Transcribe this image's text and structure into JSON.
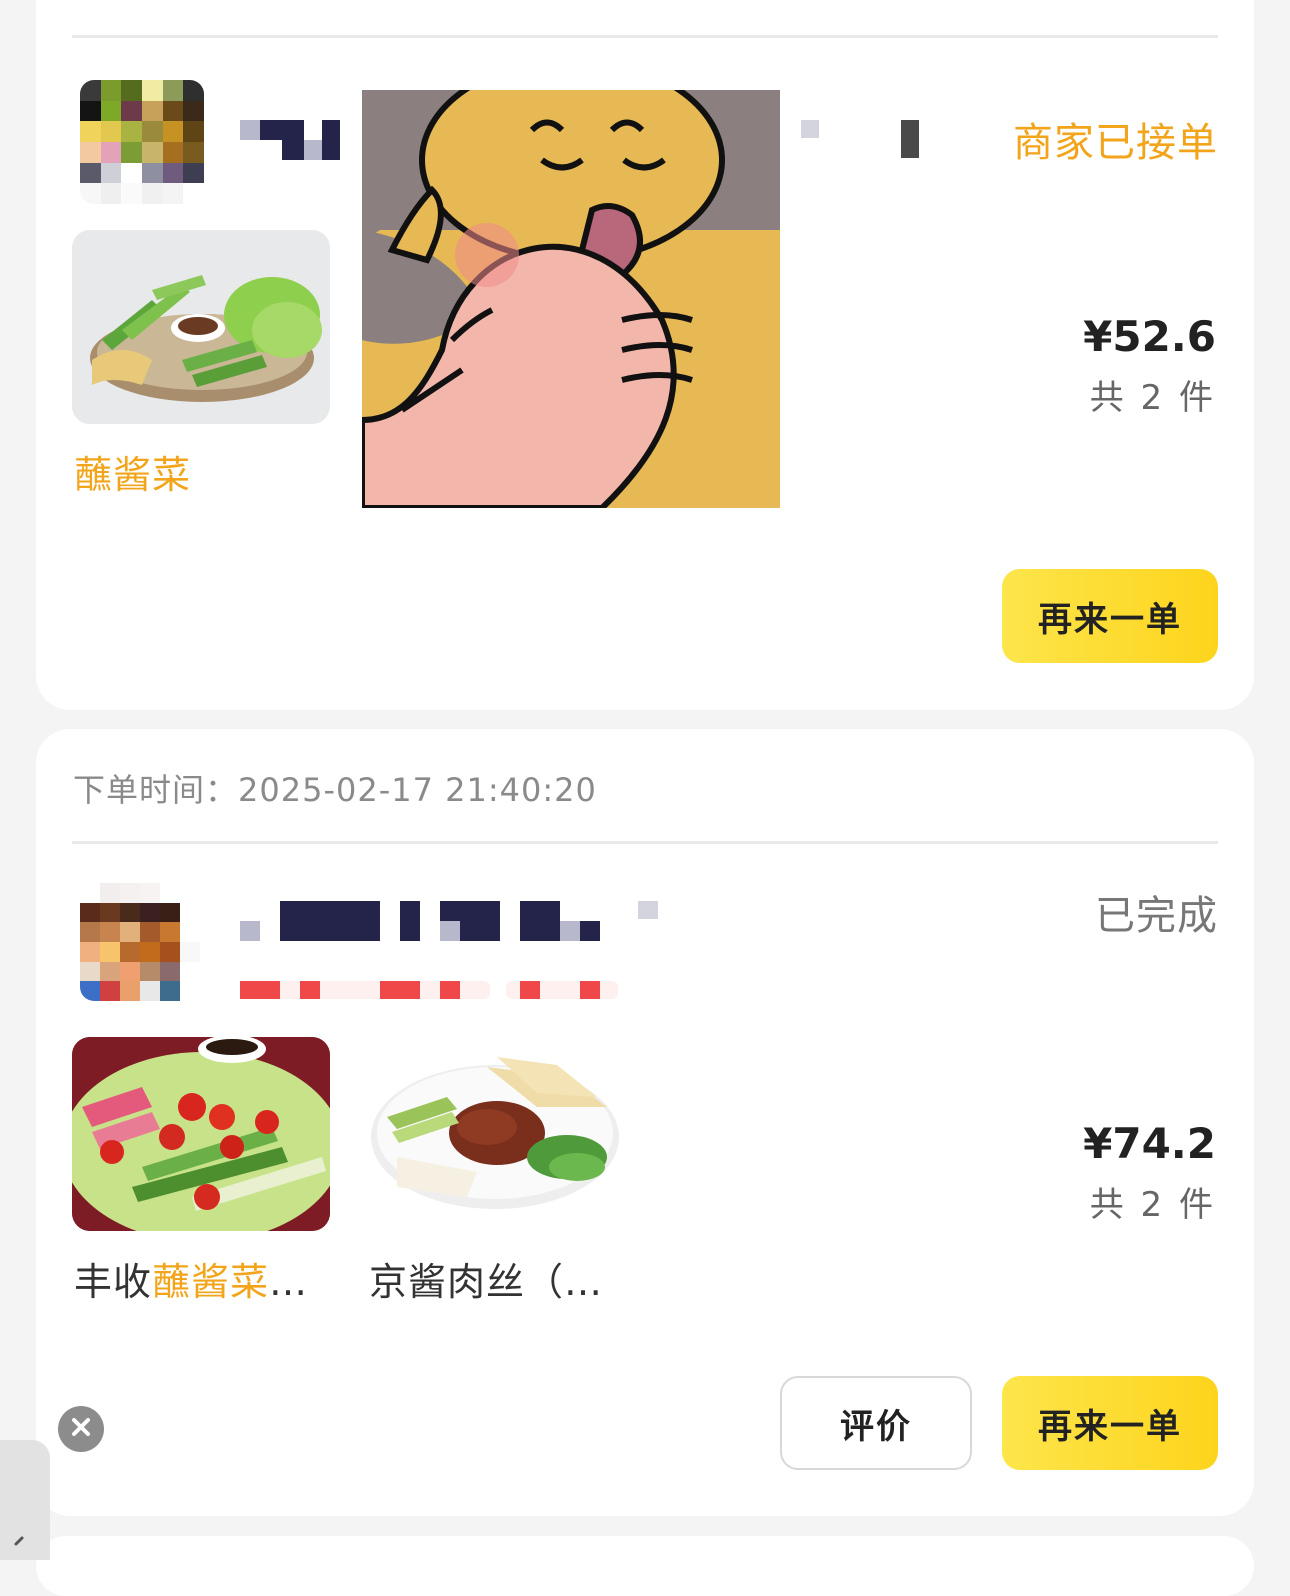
{
  "orders": [
    {
      "status": "商家已接单",
      "items": [
        {
          "name_highlight": "蘸酱菜"
        }
      ],
      "price": "¥52.6",
      "count": "共 2 件",
      "actions": [
        "再来一单"
      ]
    },
    {
      "order_time_label": "下单时间：",
      "order_time_value": "2025-02-17 21:40:20",
      "status": "已完成",
      "items": [
        {
          "name_prefix": "丰收",
          "name_highlight": "蘸酱菜",
          "name_suffix": "…"
        },
        {
          "name": "京酱肉丝（…"
        }
      ],
      "price": "¥74.2",
      "count": "共 2 件",
      "actions": [
        "评价",
        "再来一单"
      ]
    }
  ],
  "colors": {
    "accent": "#f2a51a",
    "button_yellow": "#fdd41c",
    "status_done": "#777777",
    "background": "#f4f4f4"
  },
  "icons": [
    "close-icon",
    "chevron-icon"
  ]
}
